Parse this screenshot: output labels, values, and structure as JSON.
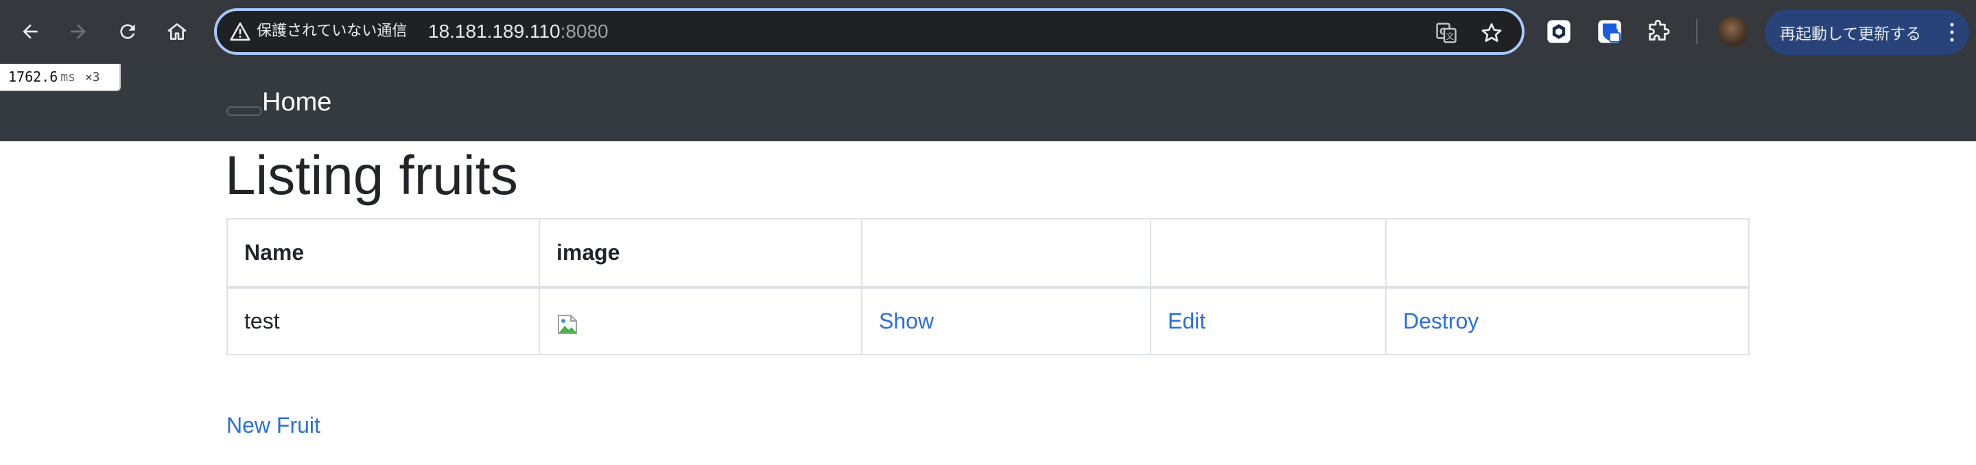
{
  "browser": {
    "insecure_label": "保護されていない通信",
    "url_host": "18.181.189.110",
    "url_port": ":8080",
    "update_button_label": "再起動して更新する",
    "icons": [
      "back-icon",
      "forward-icon",
      "reload-icon",
      "home-icon",
      "warning-icon",
      "translate-icon",
      "star-icon",
      "extension-icon",
      "bitwarden-icon",
      "puzzle-icon",
      "kebab-menu-icon"
    ],
    "colors": {
      "chrome_bg": "#35383c",
      "omnibox_border": "#a8c7fa",
      "update_button_bg": "#28437a"
    }
  },
  "perf_overlay": {
    "value": "1762.6",
    "unit": "ms",
    "multiplier": "✕3"
  },
  "navbar": {
    "brand": "Home",
    "bg_color": "#343a40"
  },
  "page": {
    "title": "Listing fruits",
    "table": {
      "headers": [
        "Name",
        "image",
        "",
        "",
        ""
      ],
      "rows": [
        {
          "name": "test",
          "image_alt": "",
          "show": "Show",
          "edit": "Edit",
          "destroy": "Destroy"
        }
      ]
    },
    "new_link": "New Fruit",
    "link_color": "#2a6fdb"
  }
}
